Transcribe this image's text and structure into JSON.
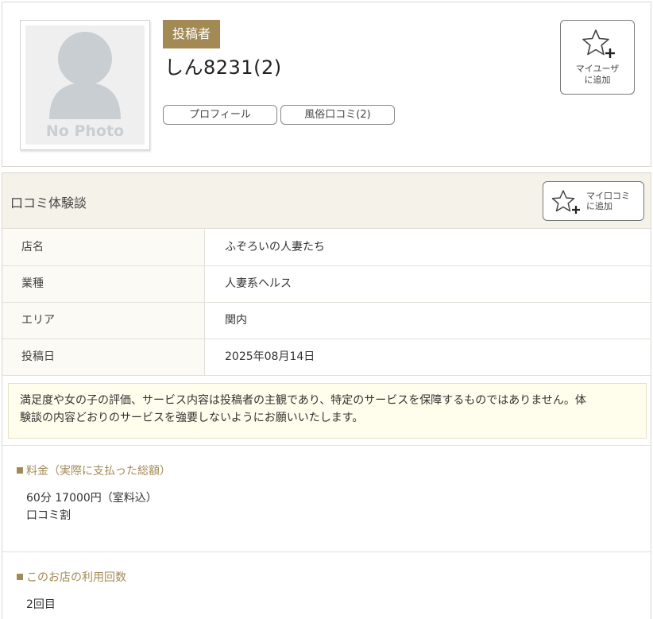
{
  "profile": {
    "no_photo_text": "No Photo",
    "role_badge": "投稿者",
    "user_name": "しん8231(2)",
    "profile_button": "プロフィール",
    "reviews_button": "風俗口コミ(2)",
    "myuser_button": {
      "line1": "マイユーザ",
      "line2": "に追加"
    }
  },
  "review": {
    "section_title": "口コミ体験談",
    "mykuchi_button": {
      "line1": "マイ口コミ",
      "line2": "に追加"
    },
    "info_rows": [
      {
        "label": "店名",
        "value": "ふぞろいの人妻たち"
      },
      {
        "label": "業種",
        "value": "人妻系ヘルス"
      },
      {
        "label": "エリア",
        "value": "関内"
      },
      {
        "label": "投稿日",
        "value": "2025年08月14日"
      }
    ],
    "notice": {
      "line1": "満足度や女の子の評価、サービス内容は投稿者の主観であり、特定のサービスを保障するものではありません。体",
      "line2": "験談の内容どおりのサービスを強要しないようにお願いいたします。"
    },
    "price": {
      "heading": "料金（実際に支払った総額）",
      "line1": "60分 17000円（室料込）",
      "line2": "口コミ割"
    },
    "visits": {
      "heading": "このお店の利用回数",
      "value": "2回目"
    }
  },
  "colors": {
    "accent_gold": "#a38a55",
    "header_beige": "#f5f2e9",
    "notice_bg": "#fffdec"
  }
}
